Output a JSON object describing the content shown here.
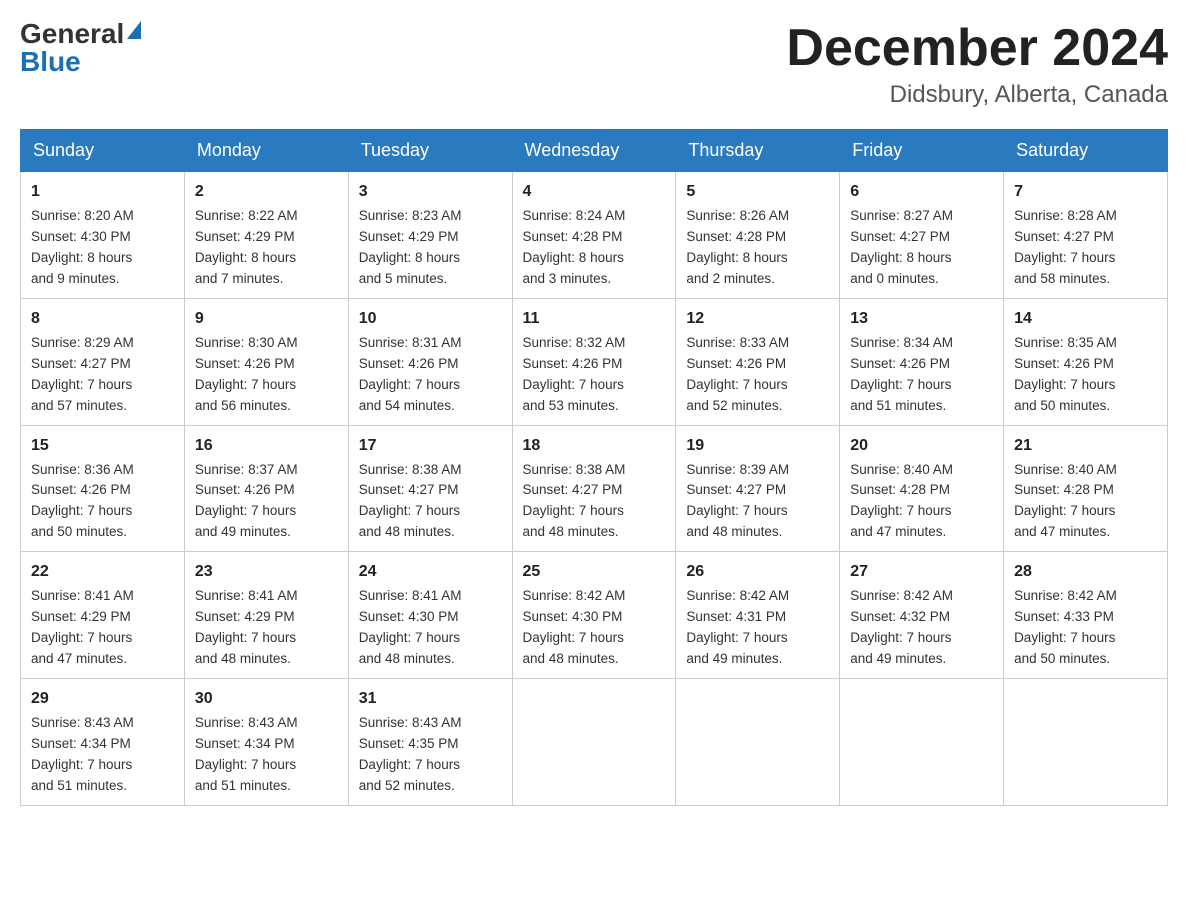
{
  "header": {
    "logo_general": "General",
    "logo_blue": "Blue",
    "month_title": "December 2024",
    "location": "Didsbury, Alberta, Canada"
  },
  "days_of_week": [
    "Sunday",
    "Monday",
    "Tuesday",
    "Wednesday",
    "Thursday",
    "Friday",
    "Saturday"
  ],
  "weeks": [
    [
      {
        "day": "1",
        "sunrise": "Sunrise: 8:20 AM",
        "sunset": "Sunset: 4:30 PM",
        "daylight": "Daylight: 8 hours",
        "daylight2": "and 9 minutes."
      },
      {
        "day": "2",
        "sunrise": "Sunrise: 8:22 AM",
        "sunset": "Sunset: 4:29 PM",
        "daylight": "Daylight: 8 hours",
        "daylight2": "and 7 minutes."
      },
      {
        "day": "3",
        "sunrise": "Sunrise: 8:23 AM",
        "sunset": "Sunset: 4:29 PM",
        "daylight": "Daylight: 8 hours",
        "daylight2": "and 5 minutes."
      },
      {
        "day": "4",
        "sunrise": "Sunrise: 8:24 AM",
        "sunset": "Sunset: 4:28 PM",
        "daylight": "Daylight: 8 hours",
        "daylight2": "and 3 minutes."
      },
      {
        "day": "5",
        "sunrise": "Sunrise: 8:26 AM",
        "sunset": "Sunset: 4:28 PM",
        "daylight": "Daylight: 8 hours",
        "daylight2": "and 2 minutes."
      },
      {
        "day": "6",
        "sunrise": "Sunrise: 8:27 AM",
        "sunset": "Sunset: 4:27 PM",
        "daylight": "Daylight: 8 hours",
        "daylight2": "and 0 minutes."
      },
      {
        "day": "7",
        "sunrise": "Sunrise: 8:28 AM",
        "sunset": "Sunset: 4:27 PM",
        "daylight": "Daylight: 7 hours",
        "daylight2": "and 58 minutes."
      }
    ],
    [
      {
        "day": "8",
        "sunrise": "Sunrise: 8:29 AM",
        "sunset": "Sunset: 4:27 PM",
        "daylight": "Daylight: 7 hours",
        "daylight2": "and 57 minutes."
      },
      {
        "day": "9",
        "sunrise": "Sunrise: 8:30 AM",
        "sunset": "Sunset: 4:26 PM",
        "daylight": "Daylight: 7 hours",
        "daylight2": "and 56 minutes."
      },
      {
        "day": "10",
        "sunrise": "Sunrise: 8:31 AM",
        "sunset": "Sunset: 4:26 PM",
        "daylight": "Daylight: 7 hours",
        "daylight2": "and 54 minutes."
      },
      {
        "day": "11",
        "sunrise": "Sunrise: 8:32 AM",
        "sunset": "Sunset: 4:26 PM",
        "daylight": "Daylight: 7 hours",
        "daylight2": "and 53 minutes."
      },
      {
        "day": "12",
        "sunrise": "Sunrise: 8:33 AM",
        "sunset": "Sunset: 4:26 PM",
        "daylight": "Daylight: 7 hours",
        "daylight2": "and 52 minutes."
      },
      {
        "day": "13",
        "sunrise": "Sunrise: 8:34 AM",
        "sunset": "Sunset: 4:26 PM",
        "daylight": "Daylight: 7 hours",
        "daylight2": "and 51 minutes."
      },
      {
        "day": "14",
        "sunrise": "Sunrise: 8:35 AM",
        "sunset": "Sunset: 4:26 PM",
        "daylight": "Daylight: 7 hours",
        "daylight2": "and 50 minutes."
      }
    ],
    [
      {
        "day": "15",
        "sunrise": "Sunrise: 8:36 AM",
        "sunset": "Sunset: 4:26 PM",
        "daylight": "Daylight: 7 hours",
        "daylight2": "and 50 minutes."
      },
      {
        "day": "16",
        "sunrise": "Sunrise: 8:37 AM",
        "sunset": "Sunset: 4:26 PM",
        "daylight": "Daylight: 7 hours",
        "daylight2": "and 49 minutes."
      },
      {
        "day": "17",
        "sunrise": "Sunrise: 8:38 AM",
        "sunset": "Sunset: 4:27 PM",
        "daylight": "Daylight: 7 hours",
        "daylight2": "and 48 minutes."
      },
      {
        "day": "18",
        "sunrise": "Sunrise: 8:38 AM",
        "sunset": "Sunset: 4:27 PM",
        "daylight": "Daylight: 7 hours",
        "daylight2": "and 48 minutes."
      },
      {
        "day": "19",
        "sunrise": "Sunrise: 8:39 AM",
        "sunset": "Sunset: 4:27 PM",
        "daylight": "Daylight: 7 hours",
        "daylight2": "and 48 minutes."
      },
      {
        "day": "20",
        "sunrise": "Sunrise: 8:40 AM",
        "sunset": "Sunset: 4:28 PM",
        "daylight": "Daylight: 7 hours",
        "daylight2": "and 47 minutes."
      },
      {
        "day": "21",
        "sunrise": "Sunrise: 8:40 AM",
        "sunset": "Sunset: 4:28 PM",
        "daylight": "Daylight: 7 hours",
        "daylight2": "and 47 minutes."
      }
    ],
    [
      {
        "day": "22",
        "sunrise": "Sunrise: 8:41 AM",
        "sunset": "Sunset: 4:29 PM",
        "daylight": "Daylight: 7 hours",
        "daylight2": "and 47 minutes."
      },
      {
        "day": "23",
        "sunrise": "Sunrise: 8:41 AM",
        "sunset": "Sunset: 4:29 PM",
        "daylight": "Daylight: 7 hours",
        "daylight2": "and 48 minutes."
      },
      {
        "day": "24",
        "sunrise": "Sunrise: 8:41 AM",
        "sunset": "Sunset: 4:30 PM",
        "daylight": "Daylight: 7 hours",
        "daylight2": "and 48 minutes."
      },
      {
        "day": "25",
        "sunrise": "Sunrise: 8:42 AM",
        "sunset": "Sunset: 4:30 PM",
        "daylight": "Daylight: 7 hours",
        "daylight2": "and 48 minutes."
      },
      {
        "day": "26",
        "sunrise": "Sunrise: 8:42 AM",
        "sunset": "Sunset: 4:31 PM",
        "daylight": "Daylight: 7 hours",
        "daylight2": "and 49 minutes."
      },
      {
        "day": "27",
        "sunrise": "Sunrise: 8:42 AM",
        "sunset": "Sunset: 4:32 PM",
        "daylight": "Daylight: 7 hours",
        "daylight2": "and 49 minutes."
      },
      {
        "day": "28",
        "sunrise": "Sunrise: 8:42 AM",
        "sunset": "Sunset: 4:33 PM",
        "daylight": "Daylight: 7 hours",
        "daylight2": "and 50 minutes."
      }
    ],
    [
      {
        "day": "29",
        "sunrise": "Sunrise: 8:43 AM",
        "sunset": "Sunset: 4:34 PM",
        "daylight": "Daylight: 7 hours",
        "daylight2": "and 51 minutes."
      },
      {
        "day": "30",
        "sunrise": "Sunrise: 8:43 AM",
        "sunset": "Sunset: 4:34 PM",
        "daylight": "Daylight: 7 hours",
        "daylight2": "and 51 minutes."
      },
      {
        "day": "31",
        "sunrise": "Sunrise: 8:43 AM",
        "sunset": "Sunset: 4:35 PM",
        "daylight": "Daylight: 7 hours",
        "daylight2": "and 52 minutes."
      },
      {
        "day": "",
        "sunrise": "",
        "sunset": "",
        "daylight": "",
        "daylight2": ""
      },
      {
        "day": "",
        "sunrise": "",
        "sunset": "",
        "daylight": "",
        "daylight2": ""
      },
      {
        "day": "",
        "sunrise": "",
        "sunset": "",
        "daylight": "",
        "daylight2": ""
      },
      {
        "day": "",
        "sunrise": "",
        "sunset": "",
        "daylight": "",
        "daylight2": ""
      }
    ]
  ]
}
